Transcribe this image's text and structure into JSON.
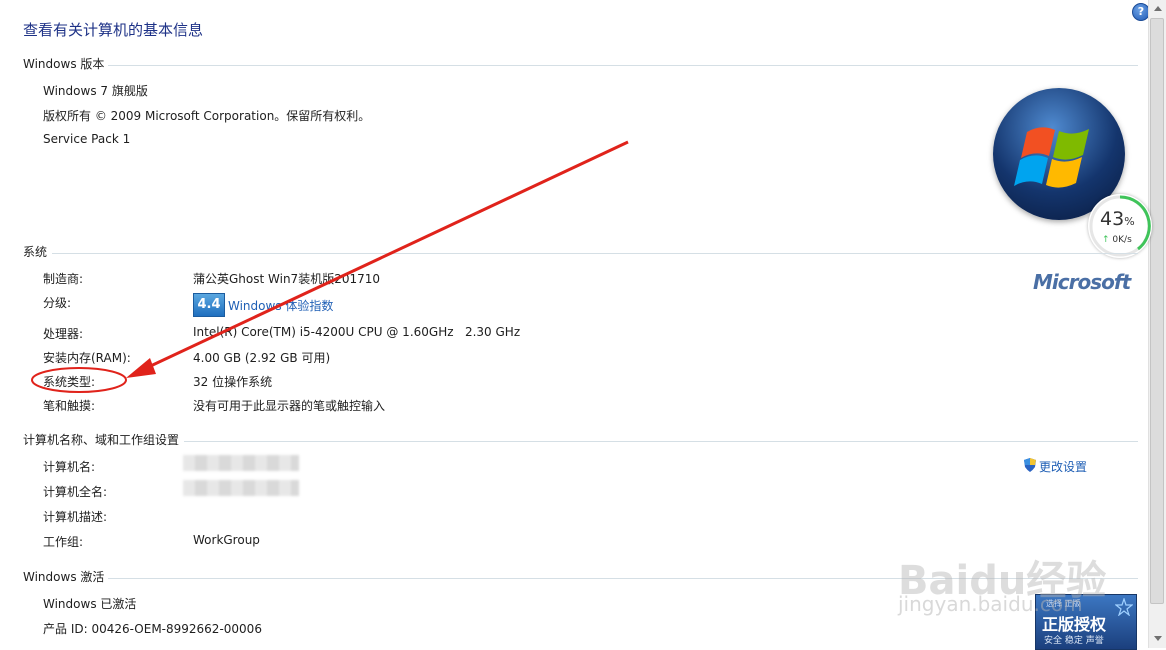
{
  "title": "查看有关计算机的基本信息",
  "help_icon": "help-icon",
  "sections": {
    "edition": {
      "title": "Windows 版本",
      "name": "Windows 7 旗舰版",
      "copyright": "版权所有 © 2009 Microsoft Corporation。保留所有权利。",
      "service_pack": "Service Pack 1"
    },
    "system": {
      "title": "系统",
      "manufacturer_label": "制造商:",
      "manufacturer_value": "蒲公英Ghost Win7装机版201710",
      "rating_label": "分级:",
      "rating_score": "4.4",
      "rating_link": "Windows 体验指数",
      "processor_label": "处理器:",
      "processor_value": "Intel(R) Core(TM) i5-4200U CPU @ 1.60GHz   2.30 GHz",
      "ram_label": "安装内存(RAM):",
      "ram_value": "4.00 GB (2.92 GB 可用)",
      "type_label": "系统类型:",
      "type_value": "32 位操作系统",
      "pen_label": "笔和触摸:",
      "pen_value": "没有可用于此显示器的笔或触控输入"
    },
    "computer": {
      "title": "计算机名称、域和工作组设置",
      "name_label": "计算机名:",
      "full_name_label": "计算机全名:",
      "description_label": "计算机描述:",
      "workgroup_label": "工作组:",
      "workgroup_value": "WorkGroup",
      "change_settings": "更改设置"
    },
    "activation": {
      "title": "Windows 激活",
      "status": "Windows 已激活",
      "product_id": "产品 ID: 00426-OEM-8992662-00006"
    }
  },
  "branding": {
    "microsoft": "Microsoft",
    "genuine_top": "选择 正版",
    "genuine_title": "正版授权",
    "genuine_sub": "安全 稳定 声誉"
  },
  "gauge": {
    "percent": "43",
    "percent_sign": "%",
    "speed": "0K/s",
    "arrow": "↑"
  },
  "watermark": {
    "line1": "Baidu经验",
    "line2": "jingyan.baidu.com"
  },
  "colors": {
    "title": "#1e3287",
    "link": "#1f5fb5",
    "annotation": "#e0231b",
    "section_line": "#d5dfe5"
  }
}
